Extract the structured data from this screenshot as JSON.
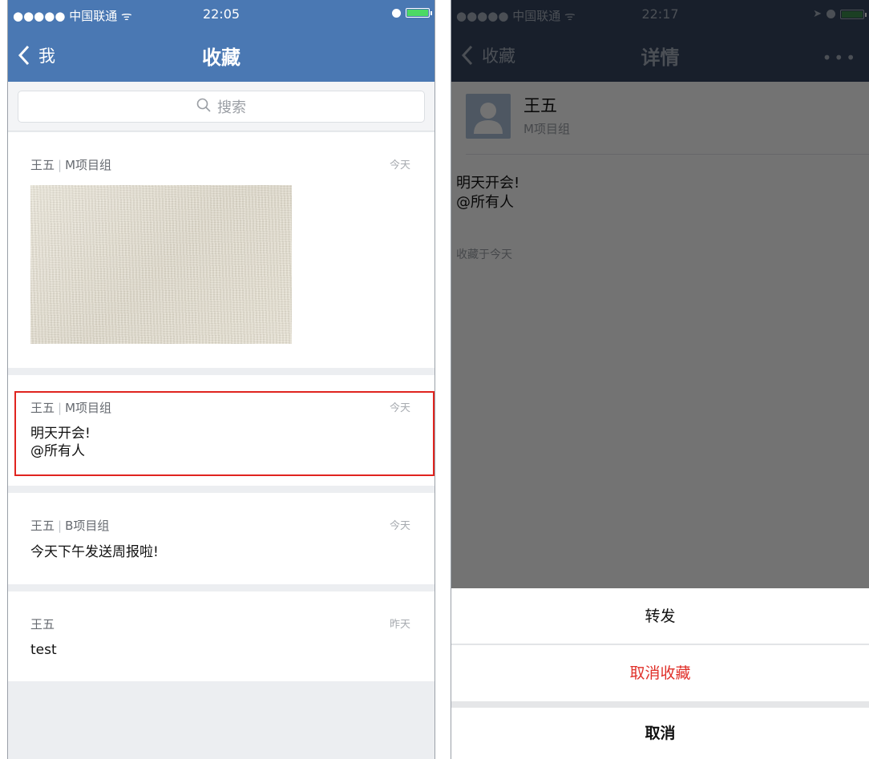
{
  "left": {
    "status": {
      "carrier": "●●●●● 中国联通",
      "time": "22:05"
    },
    "nav": {
      "back_label": "我",
      "title": "收藏"
    },
    "search": {
      "placeholder": "搜索"
    },
    "items": [
      {
        "author": "王五",
        "group": "M项目组",
        "time": "今天",
        "type": "image"
      },
      {
        "author": "王五",
        "group": "M项目组",
        "time": "今天",
        "line1": "明天开会!",
        "line2": "@所有人",
        "highlighted": true
      },
      {
        "author": "王五",
        "group": "B项目组",
        "time": "今天",
        "line1": "今天下午发送周报啦!"
      },
      {
        "author": "王五",
        "time": "昨天",
        "line1": "test"
      }
    ]
  },
  "right": {
    "status": {
      "carrier": "●●●●● 中国联通",
      "time": "22:17"
    },
    "nav": {
      "back_label": "收藏",
      "title": "详情",
      "more": "•••"
    },
    "detail": {
      "name": "王五",
      "group": "M项目组",
      "line1": "明天开会!",
      "line2": "@所有人",
      "saved": "收藏于今天"
    },
    "sheet": {
      "forward": "转发",
      "unfavorite": "取消收藏",
      "cancel": "取消"
    }
  },
  "colors": {
    "nav_blue": "#4a78b3",
    "nav_dark": "#354661",
    "highlight": "#e0241f",
    "danger": "#e0312a"
  },
  "icons": [
    "back-chevron-icon",
    "wifi-icon",
    "alarm-icon",
    "battery-icon",
    "search-icon",
    "avatar-icon",
    "more-icon",
    "location-icon"
  ]
}
